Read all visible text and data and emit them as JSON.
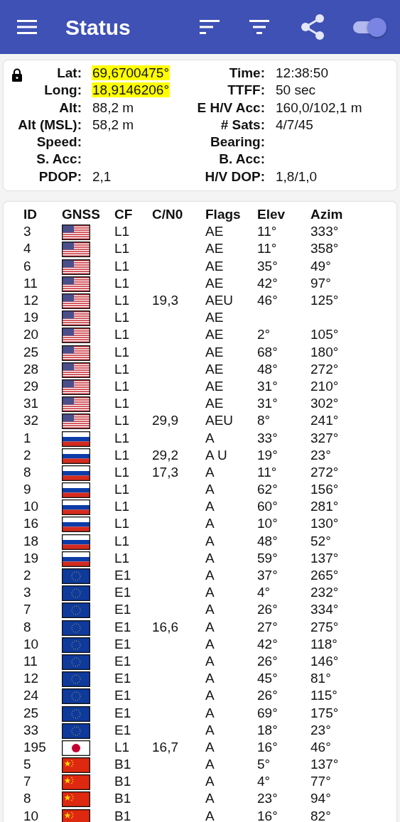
{
  "app_bar": {
    "title": "Status",
    "toggle": {
      "on": true
    }
  },
  "fix": {
    "locked": true,
    "left": [
      {
        "label": "Lat:",
        "value": "69,6700475°",
        "highlighted": true
      },
      {
        "label": "Long:",
        "value": "18,9146206°",
        "highlighted": true
      },
      {
        "label": "Alt:",
        "value": "88,2 m",
        "highlighted": false
      },
      {
        "label": "Alt (MSL):",
        "value": "58,2 m",
        "highlighted": false
      },
      {
        "label": "Speed:"
      },
      {
        "label": "S. Acc:"
      },
      {
        "label": "PDOP:",
        "value": "2,1",
        "highlighted": false
      }
    ],
    "right": [
      {
        "label": "Time:",
        "value": "12:38:50"
      },
      {
        "label": "TTFF:",
        "value": "50 sec"
      },
      {
        "label": "E H/V Acc:",
        "value": "160,0/102,1 m"
      },
      {
        "label": "# Sats:",
        "value": "4/7/45"
      },
      {
        "label": "Bearing:"
      },
      {
        "label": "B. Acc:"
      },
      {
        "label": "H/V DOP:",
        "value": "1,8/1,0"
      }
    ]
  },
  "table": {
    "columns": [
      "ID",
      "GNSS",
      "CF",
      "C/N0",
      "Flags",
      "Elev",
      "Azim"
    ],
    "rows": [
      {
        "id": "3",
        "kind": "us",
        "cf": "L1",
        "flags": "AE",
        "elev": "11°",
        "azim": "333°"
      },
      {
        "id": "4",
        "kind": "us",
        "cf": "L1",
        "flags": "AE",
        "elev": "11°",
        "azim": "358°"
      },
      {
        "id": "6",
        "kind": "us",
        "cf": "L1",
        "flags": "AE",
        "elev": "35°",
        "azim": "49°"
      },
      {
        "id": "11",
        "kind": "us",
        "cf": "L1",
        "flags": "AE",
        "elev": "42°",
        "azim": "97°"
      },
      {
        "id": "12",
        "kind": "us",
        "cf": "L1",
        "cn0": "19,3",
        "flags": "AEU",
        "elev": "46°",
        "azim": "125°"
      },
      {
        "id": "19",
        "kind": "us",
        "cf": "L1",
        "flags": "AE"
      },
      {
        "id": "20",
        "kind": "us",
        "cf": "L1",
        "flags": "AE",
        "elev": "2°",
        "azim": "105°"
      },
      {
        "id": "25",
        "kind": "us",
        "cf": "L1",
        "flags": "AE",
        "elev": "68°",
        "azim": "180°"
      },
      {
        "id": "28",
        "kind": "us",
        "cf": "L1",
        "flags": "AE",
        "elev": "48°",
        "azim": "272°"
      },
      {
        "id": "29",
        "kind": "us",
        "cf": "L1",
        "flags": "AE",
        "elev": "31°",
        "azim": "210°"
      },
      {
        "id": "31",
        "kind": "us",
        "cf": "L1",
        "flags": "AE",
        "elev": "31°",
        "azim": "302°"
      },
      {
        "id": "32",
        "kind": "us",
        "cf": "L1",
        "cn0": "29,9",
        "flags": "AEU",
        "elev": "8°",
        "azim": "241°"
      },
      {
        "id": "1",
        "kind": "ru",
        "cf": "L1",
        "flags": "A",
        "elev": "33°",
        "azim": "327°"
      },
      {
        "id": "2",
        "kind": "ru",
        "cf": "L1",
        "cn0": "29,2",
        "flags": "A U",
        "elev": "19°",
        "azim": "23°"
      },
      {
        "id": "8",
        "kind": "ru",
        "cf": "L1",
        "cn0": "17,3",
        "flags": "A",
        "elev": "11°",
        "azim": "272°"
      },
      {
        "id": "9",
        "kind": "ru",
        "cf": "L1",
        "flags": "A",
        "elev": "62°",
        "azim": "156°"
      },
      {
        "id": "10",
        "kind": "ru",
        "cf": "L1",
        "flags": "A",
        "elev": "60°",
        "azim": "281°"
      },
      {
        "id": "16",
        "kind": "ru",
        "cf": "L1",
        "flags": "A",
        "elev": "10°",
        "azim": "130°"
      },
      {
        "id": "18",
        "kind": "ru",
        "cf": "L1",
        "flags": "A",
        "elev": "48°",
        "azim": "52°"
      },
      {
        "id": "19",
        "kind": "ru",
        "cf": "L1",
        "flags": "A",
        "elev": "59°",
        "azim": "137°"
      },
      {
        "id": "2",
        "kind": "eu",
        "cf": "E1",
        "flags": "A",
        "elev": "37°",
        "azim": "265°"
      },
      {
        "id": "3",
        "kind": "eu",
        "cf": "E1",
        "flags": "A",
        "elev": "4°",
        "azim": "232°"
      },
      {
        "id": "7",
        "kind": "eu",
        "cf": "E1",
        "flags": "A",
        "elev": "26°",
        "azim": "334°"
      },
      {
        "id": "8",
        "kind": "eu",
        "cf": "E1",
        "cn0": "16,6",
        "flags": "A",
        "elev": "27°",
        "azim": "275°"
      },
      {
        "id": "10",
        "kind": "eu",
        "cf": "E1",
        "flags": "A",
        "elev": "42°",
        "azim": "118°"
      },
      {
        "id": "11",
        "kind": "eu",
        "cf": "E1",
        "flags": "A",
        "elev": "26°",
        "azim": "146°"
      },
      {
        "id": "12",
        "kind": "eu",
        "cf": "E1",
        "flags": "A",
        "elev": "45°",
        "azim": "81°"
      },
      {
        "id": "24",
        "kind": "eu",
        "cf": "E1",
        "flags": "A",
        "elev": "26°",
        "azim": "115°"
      },
      {
        "id": "25",
        "kind": "eu",
        "cf": "E1",
        "flags": "A",
        "elev": "69°",
        "azim": "175°"
      },
      {
        "id": "33",
        "kind": "eu",
        "cf": "E1",
        "flags": "A",
        "elev": "18°",
        "azim": "23°"
      },
      {
        "id": "195",
        "kind": "jp",
        "cf": "L1",
        "cn0": "16,7",
        "flags": "A",
        "elev": "16°",
        "azim": "46°"
      },
      {
        "id": "5",
        "kind": "cn",
        "cf": "B1",
        "flags": "A",
        "elev": "5°",
        "azim": "137°"
      },
      {
        "id": "7",
        "kind": "cn",
        "cf": "B1",
        "flags": "A",
        "elev": "4°",
        "azim": "77°"
      },
      {
        "id": "8",
        "kind": "cn",
        "cf": "B1",
        "flags": "A",
        "elev": "23°",
        "azim": "94°"
      },
      {
        "id": "10",
        "kind": "cn",
        "cf": "B1",
        "flags": "A",
        "elev": "16°",
        "azim": "82°"
      }
    ]
  }
}
